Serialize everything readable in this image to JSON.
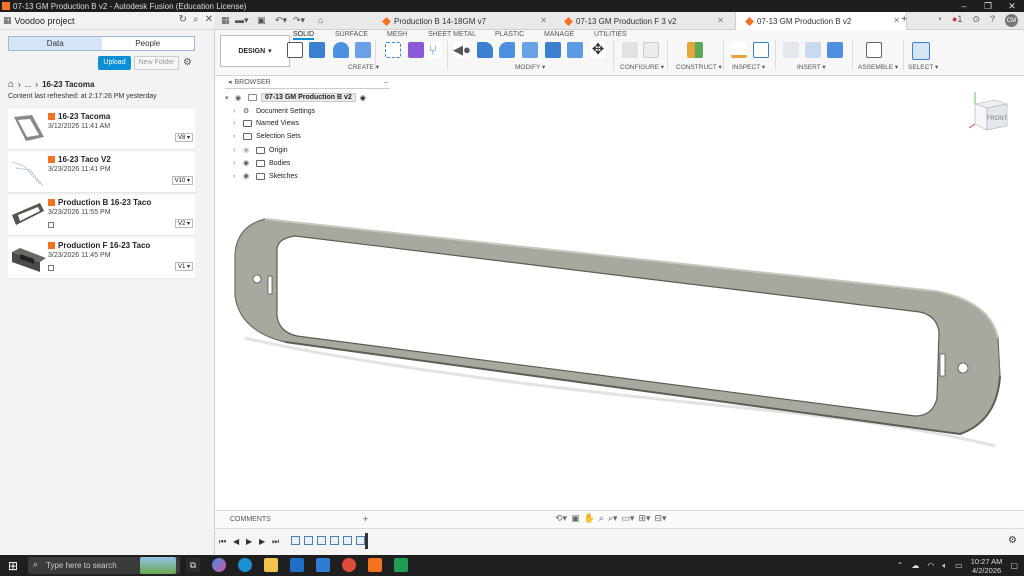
{
  "window": {
    "title": "07-13 GM Production B v2 - Autodesk Fusion (Education License)"
  },
  "left_header": {
    "project": "Voodoo project"
  },
  "tabs": [
    {
      "label": "Production B 14-18GM v7",
      "active": false
    },
    {
      "label": "07-13 GM Production F 3 v2",
      "active": false
    },
    {
      "label": "07-13 GM Production B v2",
      "active": true
    }
  ],
  "top_right": {
    "notification_count": "1",
    "user_initials": "CM"
  },
  "data_panel": {
    "tabs": [
      "Data",
      "People"
    ],
    "upload_label": "Upload",
    "new_folder_label": "New Folder",
    "breadcrumb_ellipsis": "...",
    "breadcrumb_current": "16-23 Tacoma",
    "refresh_text": "Content last refreshed: at 2:17:26 PM yesterday",
    "files": [
      {
        "name": "16-23 Tacoma",
        "date": "3/12/2026 11:41 AM",
        "version": "V8"
      },
      {
        "name": "16-23 Taco V2",
        "date": "3/23/2026 11:41 PM",
        "version": "V10"
      },
      {
        "name": "Production B 16-23 Taco",
        "date": "3/23/2026 11:55 PM",
        "version": "V2"
      },
      {
        "name": "Production F 16-23 Taco",
        "date": "3/23/2026 11:45 PM",
        "version": "V1"
      }
    ]
  },
  "toolbar": {
    "workspace": "DESIGN",
    "workspace_tabs": [
      "SOLID",
      "SURFACE",
      "MESH",
      "SHEET METAL",
      "PLASTIC",
      "MANAGE",
      "UTILITIES"
    ],
    "groups": [
      "CREATE",
      "MODIFY",
      "CONFIGURE",
      "CONSTRUCT",
      "INSPECT",
      "INSERT",
      "ASSEMBLE",
      "SELECT"
    ]
  },
  "browser": {
    "title": "BROWSER",
    "root": "07-13 GM Production B v2",
    "nodes": [
      "Document Settings",
      "Named Views",
      "Selection Sets",
      "Origin",
      "Bodies",
      "Sketches"
    ]
  },
  "viewcube": {
    "face": "FRONT"
  },
  "comments": {
    "label": "COMMENTS"
  },
  "taskbar": {
    "search_placeholder": "Type here to search",
    "time": "10:27 AM",
    "date": "4/2/2026"
  },
  "colors": {
    "accent": "#0b8fd6",
    "fusion_orange": "#f37321",
    "model_fill": "#a9a89e"
  }
}
